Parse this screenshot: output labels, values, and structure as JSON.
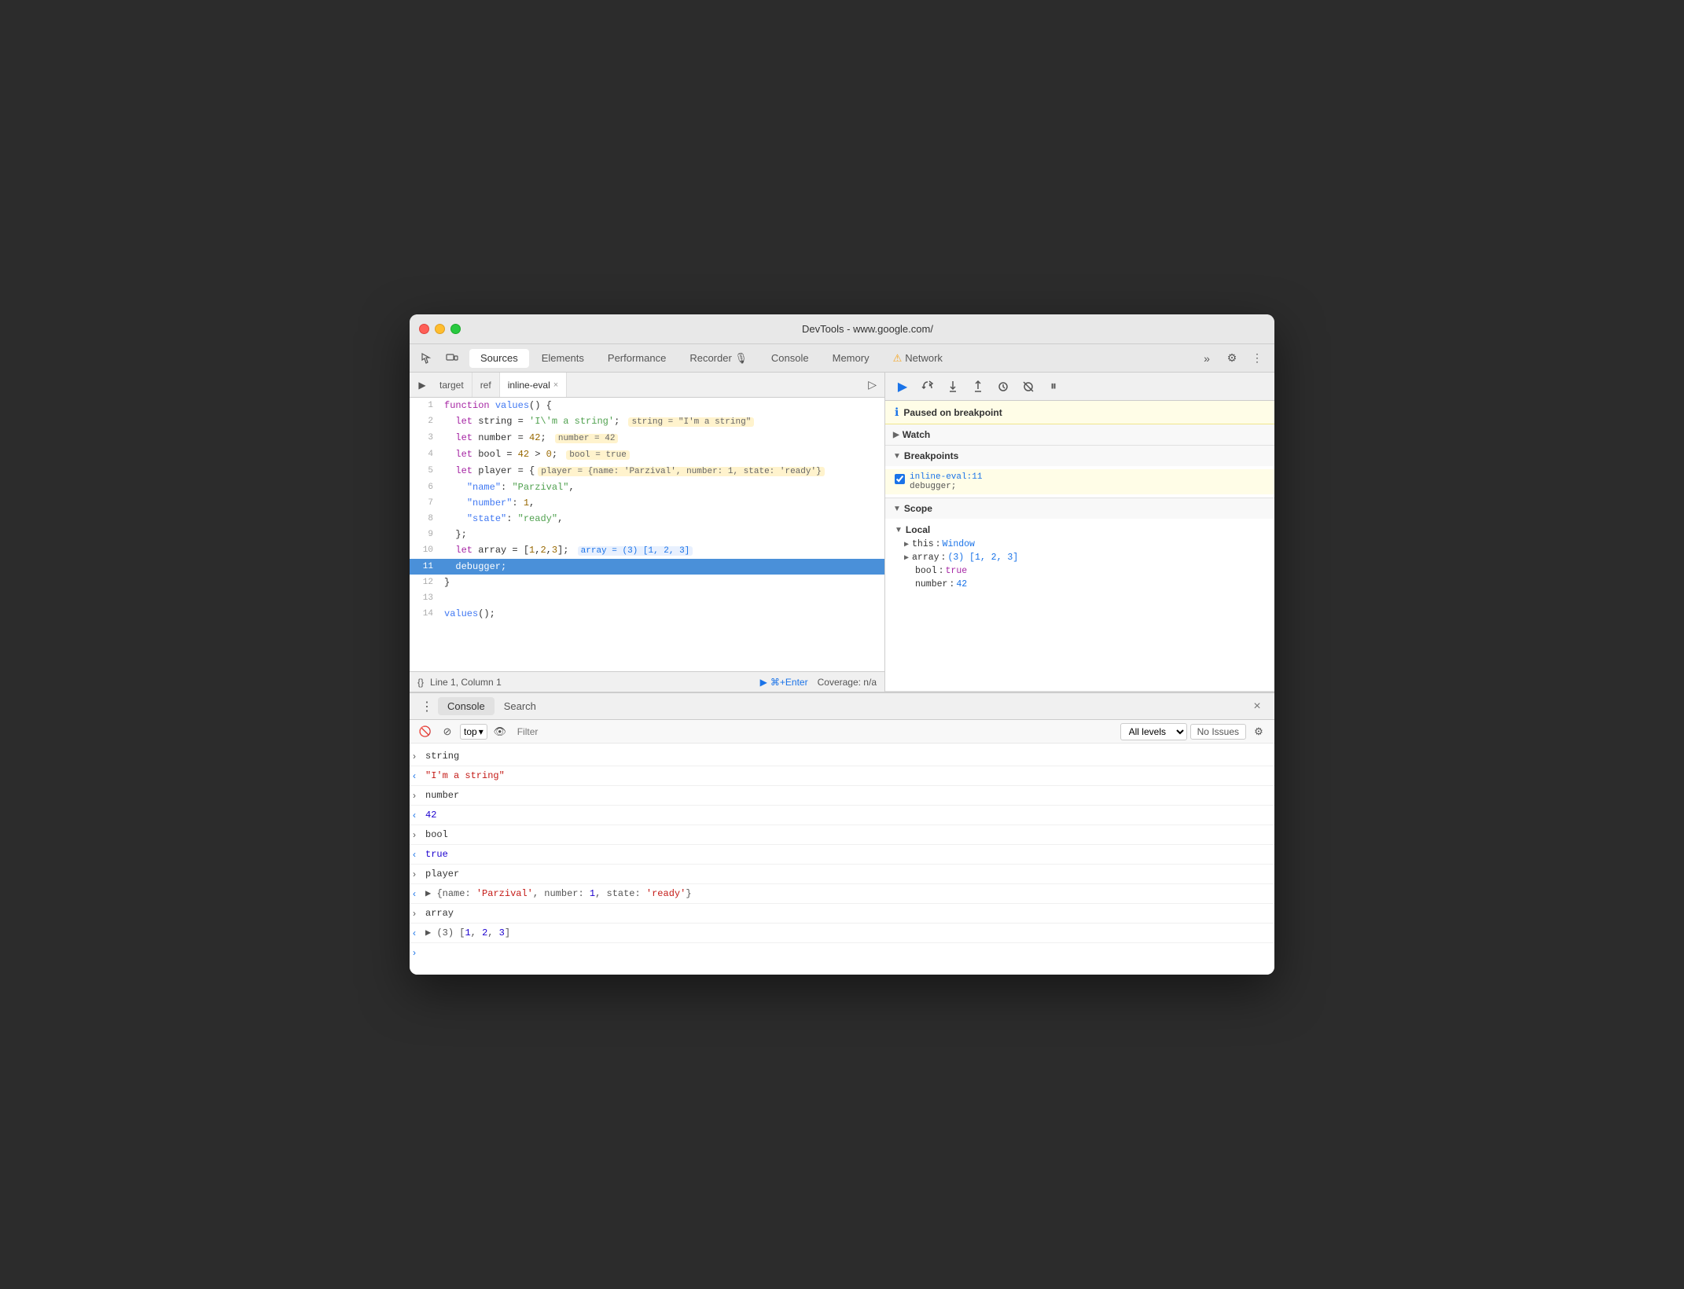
{
  "window": {
    "title": "DevTools - www.google.com/"
  },
  "traffic_lights": {
    "red_label": "close",
    "yellow_label": "minimize",
    "green_label": "maximize"
  },
  "top_nav": {
    "tabs": [
      {
        "id": "sources",
        "label": "Sources",
        "active": true
      },
      {
        "id": "elements",
        "label": "Elements",
        "active": false
      },
      {
        "id": "performance",
        "label": "Performance",
        "active": false
      },
      {
        "id": "recorder",
        "label": "Recorder 🎙",
        "active": false
      },
      {
        "id": "console",
        "label": "Console",
        "active": false
      },
      {
        "id": "memory",
        "label": "Memory",
        "active": false
      },
      {
        "id": "network",
        "label": "Network",
        "active": false,
        "warning": true
      }
    ],
    "more_tabs": "»",
    "settings_label": "⚙",
    "more_options_label": "⋮"
  },
  "source_tabs": {
    "tabs": [
      {
        "id": "target",
        "label": "target",
        "closeable": false
      },
      {
        "id": "ref",
        "label": "ref",
        "closeable": false
      },
      {
        "id": "inline-eval",
        "label": "inline-eval",
        "closeable": true,
        "active": true
      }
    ]
  },
  "code": {
    "lines": [
      {
        "num": 1,
        "content": "function values() {"
      },
      {
        "num": 2,
        "content": "  let string = 'I\\'m a string';",
        "inline": "string = \"I'm a string\""
      },
      {
        "num": 3,
        "content": "  let number = 42;",
        "inline": "number = 42"
      },
      {
        "num": 4,
        "content": "  let bool = 42 > 0;",
        "inline": "bool = true"
      },
      {
        "num": 5,
        "content": "  let player = {",
        "inline": "player = {name: 'Parzival', number: 1, state: 'ready'}"
      },
      {
        "num": 6,
        "content": "    \"name\": \"Parzival\","
      },
      {
        "num": 7,
        "content": "    \"number\": 1,"
      },
      {
        "num": 8,
        "content": "    \"state\": \"ready\","
      },
      {
        "num": 9,
        "content": "  };"
      },
      {
        "num": 10,
        "content": "  let array = [1,2,3];",
        "inline": "array = (3) [1, 2, 3]"
      },
      {
        "num": 11,
        "content": "  debugger;",
        "active": true
      },
      {
        "num": 12,
        "content": "}"
      },
      {
        "num": 13,
        "content": ""
      },
      {
        "num": 14,
        "content": "values();"
      }
    ]
  },
  "status_bar": {
    "braces": "{}",
    "position": "Line 1, Column 1",
    "run_label": "⌘+Enter",
    "coverage": "Coverage: n/a"
  },
  "debug_toolbar": {
    "buttons": [
      {
        "id": "resume",
        "icon": "▶",
        "label": "Resume",
        "active": true
      },
      {
        "id": "step-over",
        "icon": "↷",
        "label": "Step over"
      },
      {
        "id": "step-into",
        "icon": "↓",
        "label": "Step into"
      },
      {
        "id": "step-out",
        "icon": "↑",
        "label": "Step out"
      },
      {
        "id": "step",
        "icon": "→",
        "label": "Step"
      },
      {
        "id": "deactivate",
        "icon": "⛔",
        "label": "Deactivate breakpoints"
      },
      {
        "id": "pause-exceptions",
        "icon": "⏸",
        "label": "Pause on exceptions"
      }
    ]
  },
  "breakpoint_banner": {
    "text": "Paused on breakpoint"
  },
  "watch": {
    "label": "Watch",
    "expanded": false
  },
  "breakpoints": {
    "label": "Breakpoints",
    "expanded": true,
    "items": [
      {
        "file": "inline-eval:11",
        "code": "debugger;",
        "checked": true
      }
    ]
  },
  "scope": {
    "label": "Scope",
    "expanded": true,
    "local_label": "Local",
    "items": [
      {
        "key": "this",
        "colon": ":",
        "value": "Window",
        "expandable": true
      },
      {
        "key": "array",
        "colon": ":",
        "value": "(3) [1, 2, 3]",
        "expandable": true,
        "color": "blue"
      },
      {
        "key": "bool",
        "colon": ":",
        "value": "true",
        "expandable": false,
        "color": "purple"
      },
      {
        "key": "number",
        "colon": ":",
        "value": "42",
        "expandable": false,
        "color": "blue"
      }
    ]
  },
  "console_panel": {
    "tabs": [
      {
        "id": "console",
        "label": "Console",
        "active": true
      },
      {
        "id": "search",
        "label": "Search",
        "active": false
      }
    ],
    "toolbar": {
      "top_selector": "top",
      "filter_placeholder": "Filter",
      "level_label": "All levels",
      "no_issues_label": "No Issues"
    },
    "rows": [
      {
        "arrow": ">",
        "arrow_dir": "right",
        "content": "string",
        "type": "string"
      },
      {
        "arrow": "<",
        "arrow_dir": "left",
        "content": "\"I'm a string\"",
        "type": "string-val"
      },
      {
        "arrow": ">",
        "arrow_dir": "right",
        "content": "number",
        "type": "string"
      },
      {
        "arrow": "<",
        "arrow_dir": "left",
        "content": "42",
        "type": "num"
      },
      {
        "arrow": ">",
        "arrow_dir": "right",
        "content": "bool",
        "type": "string"
      },
      {
        "arrow": "<",
        "arrow_dir": "left",
        "content": "true",
        "type": "num"
      },
      {
        "arrow": ">",
        "arrow_dir": "right",
        "content": "player",
        "type": "string"
      },
      {
        "arrow": "<",
        "arrow_dir": "left",
        "content": "▶ {name: 'Parzival', number: 1, state: 'ready'}",
        "type": "blue"
      },
      {
        "arrow": ">",
        "arrow_dir": "right",
        "content": "array",
        "type": "string"
      },
      {
        "arrow": "<",
        "arrow_dir": "left",
        "content": "▶ (3) [1, 2, 3]",
        "type": "blue"
      }
    ],
    "prompt": ">"
  }
}
